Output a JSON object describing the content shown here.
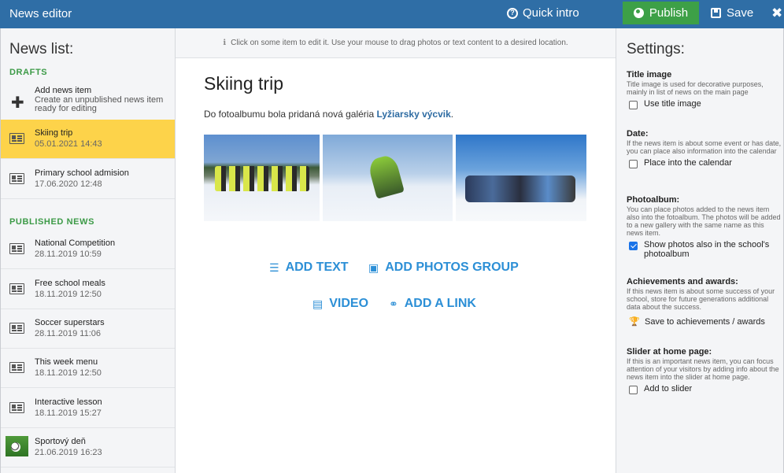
{
  "app": {
    "title": "News editor"
  },
  "toolbar": {
    "quick_intro": "Quick intro",
    "publish": "Publish",
    "save": "Save",
    "close_glyph": "✖"
  },
  "sidebar": {
    "title": "News list:",
    "drafts_label": "DRAFTS",
    "add_news": {
      "title": "Add news item",
      "description": "Create an unpublished news item ready for editing"
    },
    "drafts": [
      {
        "title": "Skiing trip",
        "date": "05.01.2021 14:43",
        "selected": true
      },
      {
        "title": "Primary school admision",
        "date": "17.06.2020 12:48"
      }
    ],
    "published_label": "PUBLISHED NEWS",
    "published": [
      {
        "title": "National Competition",
        "date": "28.11.2019 10:59"
      },
      {
        "title": "Free school meals",
        "date": "18.11.2019 12:50"
      },
      {
        "title": "Soccer superstars",
        "date": "28.11.2019 11:06"
      },
      {
        "title": "This week menu",
        "date": "18.11.2019 12:50"
      },
      {
        "title": "Interactive lesson",
        "date": "18.11.2019 15:27"
      },
      {
        "title": "Sportový deň",
        "date": "21.06.2019 16:23",
        "icon": "soccer-ball-thumbnail"
      }
    ]
  },
  "editor": {
    "hint": "Click on some item to edit it. Use your mouse to drag photos or text content to a desired location.",
    "title": "Skiing trip",
    "body_prefix": "Do fotoalbumu bola pridaná nová galéria ",
    "body_link": "Lyžiarsky výcvik",
    "body_suffix": ".",
    "actions": {
      "add_text": "ADD TEXT",
      "add_photos_group": "ADD PHOTOS GROUP",
      "video": "VIDEO",
      "add_link": "ADD A LINK"
    }
  },
  "settings": {
    "title": "Settings:",
    "title_image": {
      "label": "Title image",
      "description": "Title image is used for decorative purposes, mainly in list of news on the main page",
      "option": "Use title image",
      "checked": false
    },
    "date": {
      "label": "Date:",
      "description": "If the news item is about some event or has date, you can place also information into the calendar",
      "option": "Place into the calendar",
      "checked": false
    },
    "photoalbum": {
      "label": "Photoalbum:",
      "description": "You can place photos added to the news item also into the fotoalbum. The photos will be added to a new gallery with the same name as this news item.",
      "option": "Show photos also in the school's photoalbum",
      "checked": true
    },
    "achievements": {
      "label": "Achievements and awards:",
      "description": "If this news item is about some success of your school, store for future generations additional data about the success.",
      "option": "Save to achievements / awards"
    },
    "slider": {
      "label": "Slider at home page:",
      "description": "If this is an important news item, you can focus attention of your visitors by adding info about the news item into the slider at home page.",
      "option": "Add to slider",
      "checked": false
    }
  },
  "colors": {
    "topbar": "#2f6ea6",
    "publish": "#3da047",
    "selected": "#fdd34a",
    "accent": "#2c8fd6",
    "section": "#3c9a47"
  }
}
